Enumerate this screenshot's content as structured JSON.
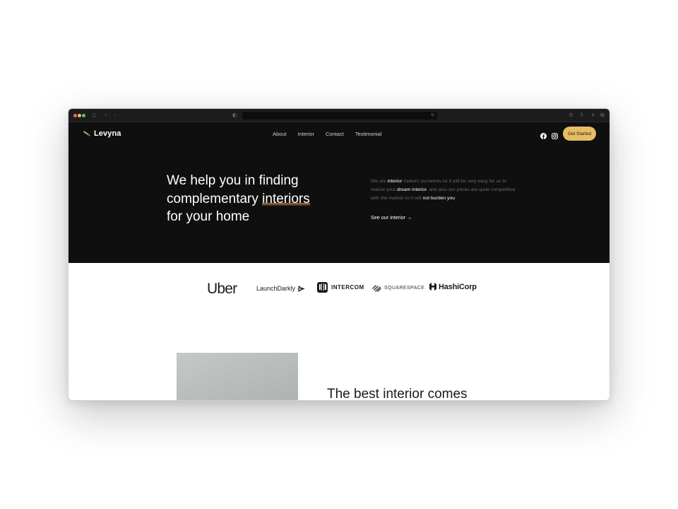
{
  "browser": {
    "icons": [
      "sidebar-icon",
      "back-icon",
      "forward-icon",
      "privacy-icon",
      "reload-icon",
      "download-icon",
      "share-icon",
      "new-tab-icon",
      "tabs-icon"
    ]
  },
  "nav": {
    "brand": "Levyna",
    "menu": [
      "About",
      "Interior",
      "Contact",
      "Testimonial"
    ],
    "social_icons": [
      "facebook-icon",
      "instagram-icon"
    ],
    "cta": "Get Started"
  },
  "hero": {
    "headline_line1": "We help you in finding",
    "headline_line2_pre": "complementary ",
    "headline_line2_highlight": "interiors",
    "headline_line3": "for your home",
    "desc_1": "We are ",
    "desc_2": "interior",
    "desc_3": " makers ourselves so it will be very easy for us to realize your ",
    "desc_4": "dream interior",
    "desc_5": ", and also our prices are quite competitive with the market so it will ",
    "desc_6": "not burden you",
    "link": "See our interior →"
  },
  "brands": {
    "uber": "Uber",
    "launchdarkly": "LaunchDarkly",
    "intercom": "INTERCOM",
    "squarespace": "SQUARESPACE",
    "hashicorp": "HashiCorp"
  },
  "section2": {
    "heading_pre": "The ",
    "heading_highlight": "best interior",
    "heading_post": " comes"
  },
  "colors": {
    "accent": "#e6bd62",
    "hero_bg": "#0f0f0f",
    "text_dark": "#1a1a1a"
  }
}
